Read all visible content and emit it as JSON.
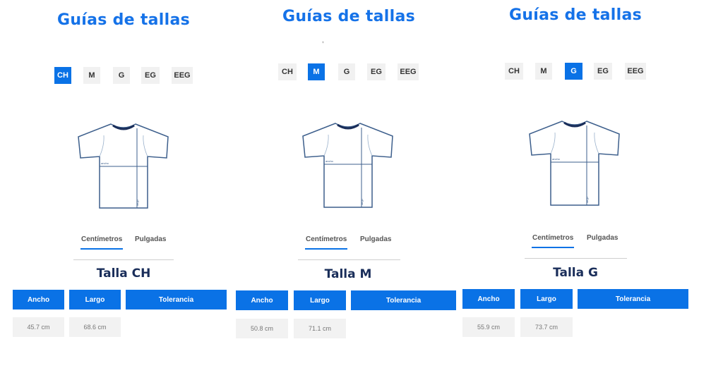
{
  "colors": {
    "accent": "#0a72e6",
    "title": "#1572e8",
    "navy": "#1a2e5a",
    "shirt_outline": "#3d5f8c"
  },
  "panels": [
    {
      "title": "Guías de tallas",
      "sizes": [
        "CH",
        "M",
        "G",
        "EG",
        "EEG"
      ],
      "active_size": "CH",
      "units": [
        "Centímetros",
        "Pulgadas"
      ],
      "active_unit": "Centímetros",
      "talla": "Talla CH",
      "shirt_labels": {
        "ancho": "ancho",
        "largo": "largo"
      },
      "columns": [
        "Ancho",
        "Largo",
        "Tolerancia"
      ],
      "values": [
        "45.7 cm",
        "68.6 cm"
      ]
    },
    {
      "title": "Guías de tallas",
      "stray_mark": ",",
      "sizes": [
        "CH",
        "M",
        "G",
        "EG",
        "EEG"
      ],
      "active_size": "M",
      "units": [
        "Centímetros",
        "Pulgadas"
      ],
      "active_unit": "Centímetros",
      "talla": "Talla M",
      "shirt_labels": {
        "ancho": "ancho",
        "largo": "largo"
      },
      "columns": [
        "Ancho",
        "Largo",
        "Tolerancia"
      ],
      "values": [
        "50.8 cm",
        "71.1 cm"
      ]
    },
    {
      "title": "Guías de tallas",
      "sizes": [
        "CH",
        "M",
        "G",
        "EG",
        "EEG"
      ],
      "active_size": "G",
      "units": [
        "Centímetros",
        "Pulgadas"
      ],
      "active_unit": "Centímetros",
      "talla": "Talla G",
      "shirt_labels": {
        "ancho": "ancho",
        "largo": "largo"
      },
      "columns": [
        "Ancho",
        "Largo",
        "Tolerancia"
      ],
      "values": [
        "55.9 cm",
        "73.7 cm"
      ]
    }
  ]
}
